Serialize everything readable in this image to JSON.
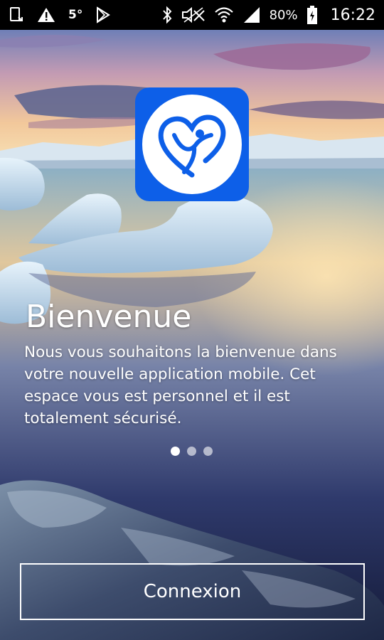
{
  "status_bar": {
    "temperature": "5°",
    "battery": "80%",
    "time": "16:22",
    "icons": [
      "screenshot-icon",
      "warning-icon",
      "temperature-icon",
      "play-store-icon",
      "bluetooth-icon",
      "mute-icon",
      "wifi-icon",
      "signal-icon",
      "battery-icon"
    ]
  },
  "onboarding": {
    "title": "Bienvenue",
    "description": "Nous vous souhaitons la bienvenue dans votre nouvelle application mobile. Cet espace vous est personnel et il est totalement sécurisé.",
    "page_count": 3,
    "active_page": 1
  },
  "logo": {
    "icon": "heart-person-logo-icon",
    "background_color": "#0d5fe8"
  },
  "actions": {
    "connect_label": "Connexion"
  }
}
